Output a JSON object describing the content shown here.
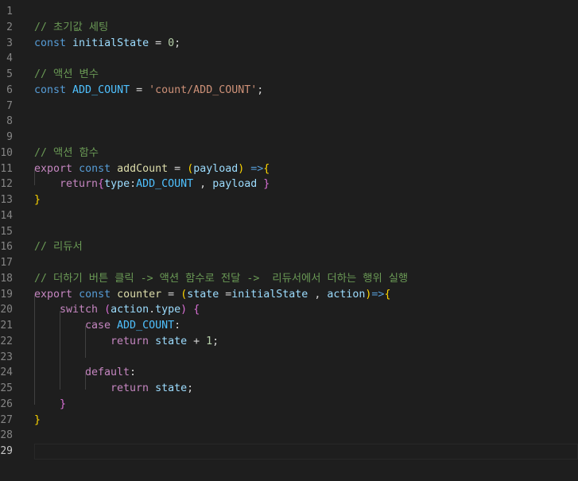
{
  "editor": {
    "active_line": 29,
    "line_numbers": [
      "1",
      "2",
      "3",
      "4",
      "5",
      "6",
      "7",
      "8",
      "9",
      "10",
      "11",
      "12",
      "13",
      "14",
      "15",
      "16",
      "17",
      "18",
      "19",
      "20",
      "21",
      "22",
      "23",
      "24",
      "25",
      "26",
      "27",
      "28",
      "29"
    ],
    "colors": {
      "background": "#1e1e1e",
      "comment": "#6a9955",
      "keyword": "#569cd6",
      "control": "#c586c0",
      "variable": "#9cdcfe",
      "constant": "#4fc1ff",
      "function": "#dcdcaa",
      "string": "#ce9178",
      "number": "#b5cea8",
      "bracket_1": "#ffd700",
      "bracket_2": "#da70d6",
      "bracket_3": "#179fff"
    },
    "lines": [
      {
        "n": 1,
        "indent": 0,
        "tokens": []
      },
      {
        "n": 2,
        "indent": 0,
        "tokens": [
          {
            "t": "// 초기값 세팅",
            "c": "comment"
          }
        ]
      },
      {
        "n": 3,
        "indent": 0,
        "tokens": [
          {
            "t": "const",
            "c": "kw"
          },
          {
            "t": " ",
            "c": "op"
          },
          {
            "t": "initialState",
            "c": "var"
          },
          {
            "t": " = ",
            "c": "op"
          },
          {
            "t": "0",
            "c": "num"
          },
          {
            "t": ";",
            "c": "op"
          }
        ]
      },
      {
        "n": 4,
        "indent": 0,
        "tokens": []
      },
      {
        "n": 5,
        "indent": 0,
        "tokens": [
          {
            "t": "// 액션 변수",
            "c": "comment"
          }
        ]
      },
      {
        "n": 6,
        "indent": 0,
        "tokens": [
          {
            "t": "const",
            "c": "kw"
          },
          {
            "t": " ",
            "c": "op"
          },
          {
            "t": "ADD_COUNT",
            "c": "const"
          },
          {
            "t": " = ",
            "c": "op"
          },
          {
            "t": "'count/ADD_COUNT'",
            "c": "str"
          },
          {
            "t": ";",
            "c": "op"
          }
        ]
      },
      {
        "n": 7,
        "indent": 0,
        "tokens": []
      },
      {
        "n": 8,
        "indent": 0,
        "tokens": []
      },
      {
        "n": 9,
        "indent": 0,
        "tokens": []
      },
      {
        "n": 10,
        "indent": 0,
        "tokens": [
          {
            "t": "// 액션 함수",
            "c": "comment"
          }
        ]
      },
      {
        "n": 11,
        "indent": 0,
        "tokens": [
          {
            "t": "export",
            "c": "ctrl"
          },
          {
            "t": " ",
            "c": "op"
          },
          {
            "t": "const",
            "c": "kw"
          },
          {
            "t": " ",
            "c": "op"
          },
          {
            "t": "addCount",
            "c": "fn"
          },
          {
            "t": " = ",
            "c": "op"
          },
          {
            "t": "(",
            "c": "b1"
          },
          {
            "t": "payload",
            "c": "var"
          },
          {
            "t": ")",
            "c": "b1"
          },
          {
            "t": " ",
            "c": "op"
          },
          {
            "t": "=>",
            "c": "kw"
          },
          {
            "t": "{",
            "c": "b1"
          }
        ]
      },
      {
        "n": 12,
        "indent": 1,
        "tokens": [
          {
            "t": "return",
            "c": "ctrl"
          },
          {
            "t": "{",
            "c": "b2"
          },
          {
            "t": "type",
            "c": "var"
          },
          {
            "t": ":",
            "c": "op"
          },
          {
            "t": "ADD_COUNT",
            "c": "const"
          },
          {
            "t": " , ",
            "c": "op"
          },
          {
            "t": "payload",
            "c": "var"
          },
          {
            "t": " ",
            "c": "op"
          },
          {
            "t": "}",
            "c": "b2"
          }
        ]
      },
      {
        "n": 13,
        "indent": 0,
        "tokens": [
          {
            "t": "}",
            "c": "b1"
          }
        ]
      },
      {
        "n": 14,
        "indent": 0,
        "tokens": []
      },
      {
        "n": 15,
        "indent": 0,
        "tokens": []
      },
      {
        "n": 16,
        "indent": 0,
        "tokens": [
          {
            "t": "// 리듀서",
            "c": "comment"
          }
        ]
      },
      {
        "n": 17,
        "indent": 0,
        "tokens": []
      },
      {
        "n": 18,
        "indent": 0,
        "tokens": [
          {
            "t": "// 더하기 버튼 클릭 -> 액션 함수로 전달 ->  리듀서에서 더하는 행위 실행",
            "c": "comment"
          }
        ]
      },
      {
        "n": 19,
        "indent": 0,
        "tokens": [
          {
            "t": "export",
            "c": "ctrl"
          },
          {
            "t": " ",
            "c": "op"
          },
          {
            "t": "const",
            "c": "kw"
          },
          {
            "t": " ",
            "c": "op"
          },
          {
            "t": "counter",
            "c": "fn"
          },
          {
            "t": " = ",
            "c": "op"
          },
          {
            "t": "(",
            "c": "b1"
          },
          {
            "t": "state",
            "c": "var"
          },
          {
            "t": " =",
            "c": "op"
          },
          {
            "t": "initialState",
            "c": "var"
          },
          {
            "t": " , ",
            "c": "op"
          },
          {
            "t": "action",
            "c": "var"
          },
          {
            "t": ")",
            "c": "b1"
          },
          {
            "t": "=>",
            "c": "kw"
          },
          {
            "t": "{",
            "c": "b1"
          }
        ]
      },
      {
        "n": 20,
        "indent": 1,
        "tokens": [
          {
            "t": "switch",
            "c": "ctrl"
          },
          {
            "t": " ",
            "c": "op"
          },
          {
            "t": "(",
            "c": "b2"
          },
          {
            "t": "action",
            "c": "var"
          },
          {
            "t": ".",
            "c": "op"
          },
          {
            "t": "type",
            "c": "var"
          },
          {
            "t": ")",
            "c": "b2"
          },
          {
            "t": " ",
            "c": "op"
          },
          {
            "t": "{",
            "c": "b2"
          }
        ]
      },
      {
        "n": 21,
        "indent": 2,
        "tokens": [
          {
            "t": "case",
            "c": "ctrl"
          },
          {
            "t": " ",
            "c": "op"
          },
          {
            "t": "ADD_COUNT",
            "c": "const"
          },
          {
            "t": ":",
            "c": "op"
          }
        ]
      },
      {
        "n": 22,
        "indent": 3,
        "tokens": [
          {
            "t": "return",
            "c": "ctrl"
          },
          {
            "t": " ",
            "c": "op"
          },
          {
            "t": "state",
            "c": "var"
          },
          {
            "t": " + ",
            "c": "op"
          },
          {
            "t": "1",
            "c": "num"
          },
          {
            "t": ";",
            "c": "op"
          }
        ]
      },
      {
        "n": 23,
        "indent": 0,
        "tokens": []
      },
      {
        "n": 24,
        "indent": 2,
        "tokens": [
          {
            "t": "default",
            "c": "ctrl"
          },
          {
            "t": ":",
            "c": "op"
          }
        ]
      },
      {
        "n": 25,
        "indent": 3,
        "tokens": [
          {
            "t": "return",
            "c": "ctrl"
          },
          {
            "t": " ",
            "c": "op"
          },
          {
            "t": "state",
            "c": "var"
          },
          {
            "t": ";",
            "c": "op"
          }
        ]
      },
      {
        "n": 26,
        "indent": 1,
        "tokens": [
          {
            "t": "}",
            "c": "b2"
          }
        ]
      },
      {
        "n": 27,
        "indent": 0,
        "tokens": [
          {
            "t": "}",
            "c": "b1"
          }
        ]
      },
      {
        "n": 28,
        "indent": 0,
        "tokens": []
      },
      {
        "n": 29,
        "indent": 0,
        "tokens": []
      }
    ]
  }
}
